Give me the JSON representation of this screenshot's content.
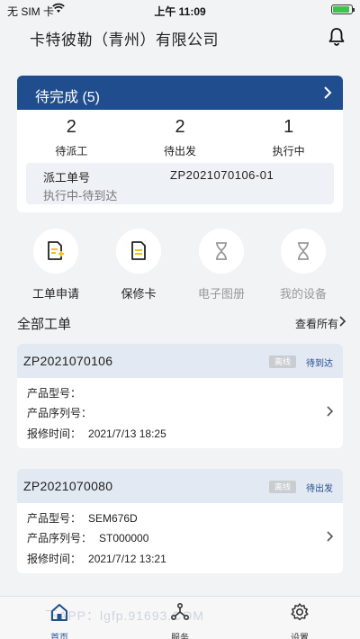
{
  "status_bar": {
    "carrier": "无 SIM 卡",
    "time": "上午 11:09",
    "battery_level": 0.85
  },
  "header": {
    "company": "卡特彼勒（青州）有限公司"
  },
  "pending": {
    "title": "待完成 (5)",
    "stats": [
      {
        "count": "2",
        "label": "待派工"
      },
      {
        "count": "2",
        "label": "待出发"
      },
      {
        "count": "1",
        "label": "执行中"
      }
    ],
    "dispatch": {
      "label": "派工单号",
      "number": "ZP2021070106-01",
      "status": "执行中-待到达"
    }
  },
  "shortcuts": [
    {
      "label": "工单申请",
      "icon": "work-order-apply-icon",
      "enabled": true
    },
    {
      "label": "保修卡",
      "icon": "warranty-card-icon",
      "enabled": true
    },
    {
      "label": "电子图册",
      "icon": "hourglass-icon",
      "enabled": false
    },
    {
      "label": "我的设备",
      "icon": "hourglass-icon",
      "enabled": false
    }
  ],
  "orders_section": {
    "title": "全部工单",
    "view_all": "查看所有"
  },
  "orders": [
    {
      "number": "ZP2021070106",
      "badge": "离线",
      "state": "待到达",
      "model_label": "产品型号：",
      "model": "",
      "serial_label": "产品序列号：",
      "serial": "",
      "time_label": "报修时间：",
      "time": "2021/7/13 18:25"
    },
    {
      "number": "ZP2021070080",
      "badge": "离线",
      "state": "待出发",
      "model_label": "产品型号：",
      "model": "SEM676D",
      "serial_label": "产品序列号：",
      "serial": "ST000000",
      "time_label": "报修时间：",
      "time": "2021/7/12 13:21"
    }
  ],
  "tabbar": {
    "home": "首页",
    "service": "服务",
    "settings": "设置"
  },
  "colors": {
    "primary": "#1f4d8e",
    "background": "#f2f3f5",
    "badge": "#c9ccd1"
  },
  "watermark": "下APP：lgfp.91693.COM"
}
